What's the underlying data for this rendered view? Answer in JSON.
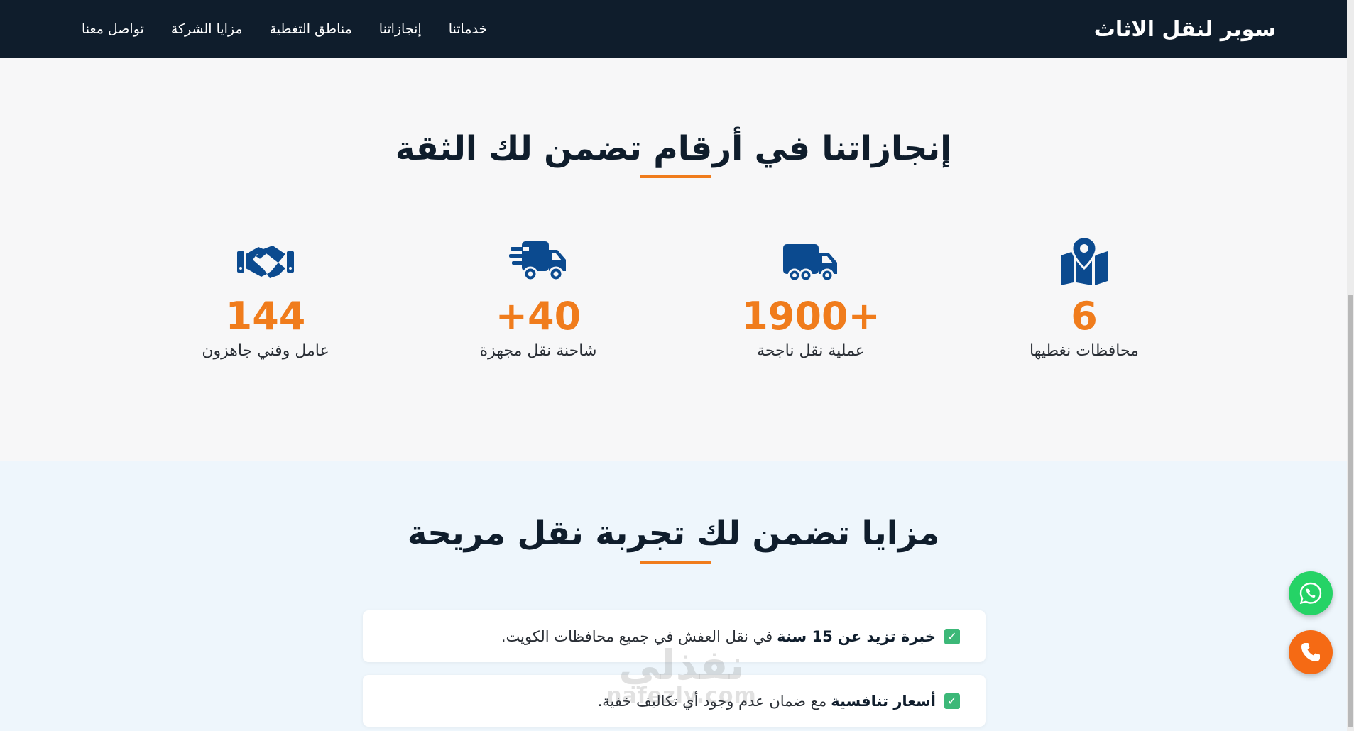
{
  "header": {
    "brand": "سوبر لنقل الاثاث",
    "nav": [
      "خدماتنا",
      "إنجازاتنا",
      "مناطق التغطية",
      "مزايا الشركة",
      "تواصل معنا"
    ]
  },
  "stats": {
    "title": "إنجازاتنا في أرقام تضمن لك الثقة",
    "items": [
      {
        "icon": "map-pin-icon",
        "value": "6",
        "label": "محافظات نغطيها"
      },
      {
        "icon": "truck-icon",
        "value": "1900+",
        "label": "عملية نقل ناجحة"
      },
      {
        "icon": "fast-truck-icon",
        "value": "+40",
        "label": "شاحنة نقل مجهزة"
      },
      {
        "icon": "handshake-icon",
        "value": "144",
        "label": "عامل وفني جاهزون"
      }
    ]
  },
  "features": {
    "title": "مزايا تضمن لك تجربة نقل مريحة",
    "items": [
      {
        "strong": "خبرة تزيد عن 15 سنة",
        "text": "في نقل العفش في جميع محافظات الكويت."
      },
      {
        "strong": "أسعار تنافسية",
        "text": "مع ضمان عدم وجود أي تكاليف خفية."
      }
    ]
  },
  "watermark": {
    "arabic": "نفذلي",
    "latin": "nafezly.com"
  },
  "colors": {
    "navy": "#0f1d2c",
    "accent": "#f07c1c",
    "icon": "#0b4a8f",
    "whatsapp": "#25d366",
    "phone": "#f56a14"
  }
}
